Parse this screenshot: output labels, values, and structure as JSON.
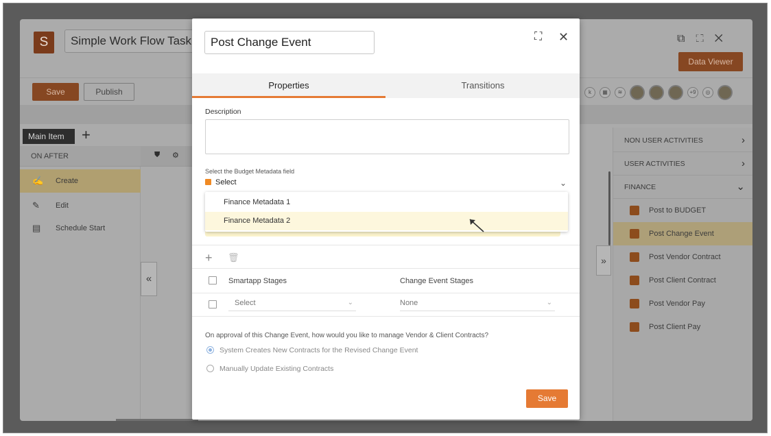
{
  "app": {
    "logo_letter": "S",
    "title": "Simple Work Flow Task",
    "save_label": "Save",
    "publish_label": "Publish",
    "data_viewer_label": "Data Viewer",
    "main_item_tab": "Main Item",
    "on_after_label": "ON AFTER",
    "left_items": [
      {
        "label": "Create",
        "icon": "hand-pen-icon"
      },
      {
        "label": "Edit",
        "icon": "pen-icon"
      },
      {
        "label": "Schedule Start",
        "icon": "calendar-clock-icon"
      }
    ],
    "right_sections": [
      {
        "label": "NON USER ACTIVITIES"
      },
      {
        "label": "USER ACTIVITIES"
      },
      {
        "label": "FINANCE"
      }
    ],
    "finance_items": [
      {
        "label": "Post to BUDGET"
      },
      {
        "label": "Post Change Event"
      },
      {
        "label": "Post Vendor Contract"
      },
      {
        "label": "Post Client Contract"
      },
      {
        "label": "Post Vendor Pay"
      },
      {
        "label": "Post Client Pay"
      }
    ],
    "collab_count": "+9"
  },
  "modal": {
    "title_value": "Post Change Event",
    "tabs": [
      {
        "label": "Properties",
        "active": true
      },
      {
        "label": "Transitions",
        "active": false
      }
    ],
    "description_label": "Description",
    "budget_field_label": "Select the Budget Metadata field",
    "budget_select_value": "Select",
    "dropdown_options": [
      "Finance Metadata 1",
      "Finance Metadata 2"
    ],
    "stage_table": {
      "headers": [
        "Smartapp Stages",
        "Change Event Stages"
      ],
      "row": {
        "smartapp_value": "Select",
        "change_event_value": "None"
      }
    },
    "approval_question": "On approval of this Change Event, how would you like to manage Vendor & Client Contracts?",
    "radio_options": [
      {
        "label": "System Creates New Contracts for the Revised Change Event",
        "selected": true
      },
      {
        "label": "Manually Update Existing Contracts",
        "selected": false
      }
    ],
    "save_label": "Save"
  },
  "colors": {
    "accent": "#e57a34",
    "tab_underline": "#e57a34",
    "dropdown_highlight": "#fdf7dd"
  }
}
